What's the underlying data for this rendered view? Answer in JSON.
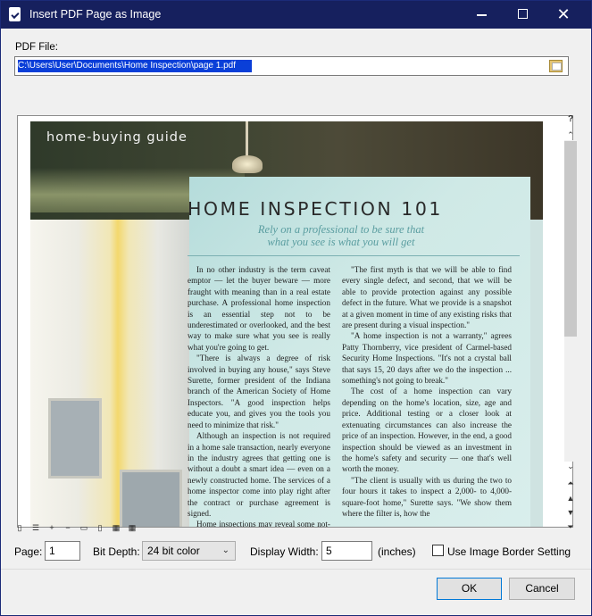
{
  "window": {
    "title": "Insert PDF Page as Image",
    "controls": {
      "minimize": "minimize",
      "maximize": "maximize",
      "close": "✕"
    }
  },
  "file": {
    "label": "PDF File:",
    "value": "C:\\Users\\User\\Documents\\Home Inspection\\page 1.pdf",
    "browse_icon": "folder-browse-icon"
  },
  "preview": {
    "kicker": "home-buying guide",
    "headline": "HOME INSPECTION 101",
    "subhead_line1": "Rely on a professional to be sure that",
    "subhead_line2": "what you see is what you will get",
    "col_a": [
      "In no other industry is the term caveat emptor — let the buyer beware — more fraught with meaning than in a real estate purchase. A professional home inspection is an essential step not to be underestimated or overlooked, and the best way to make sure what you see is really what you're going to get.",
      "\"There is always a degree of risk involved in buying any house,\" says Steve Surette, former president of the Indiana branch of the American Society of Home Inspectors. \"A good inspection helps educate you, and gives you the tools you need to minimize that risk.\"",
      "Although an inspection is not required in a home sale transaction, nearly everyone in the industry agrees that getting one is without a doubt a smart idea — even on a newly constructed home. The services of a home inspector come into play right after the contract or purchase agreement is signed.",
      "Home inspections may reveal some not-so-pleasant surprises that can make or break a sale. A thorough inspection should include"
    ],
    "col_b": [
      "\"The first myth is that we will be able to find every single defect, and second, that we will be able to provide protection against any possible defect in the future. What we provide is a snapshot at a given moment in time of any existing risks that are present during a visual inspection.\"",
      "\"A home inspection is not a warranty,\" agrees Patty Thornberry, vice president of Carmel-based Security Home Inspections. \"It's not a crystal ball that says 15, 20 days after we do the inspection ... something's not going to break.\"",
      "The cost of a home inspection can vary depending on the home's location, size, age and price. Additional testing or a closer look at extenuating circumstances can also increase the price of an inspection. However, in the end, a good inspection should be viewed as an investment in the home's safety and security — one that's well worth the money.",
      "\"The client is usually with us during the two to four hours it takes to inspect a 2,000- to 4,000-square-foot home,\" Surette says. \"We show them where the filter is, how the"
    ]
  },
  "scroll": {
    "help": "?",
    "up": "⌃",
    "down": "⌄",
    "first": "⏶",
    "prev": "▲",
    "next": "▼",
    "last": "⏷"
  },
  "view_toolbar": [
    "▯",
    "☰",
    "+",
    "−",
    "▭",
    "▯",
    "▦",
    "▦"
  ],
  "controls": {
    "page_label": "Page:",
    "page_value": "1",
    "bitdepth_label": "Bit Depth:",
    "bitdepth_value": "24 bit color",
    "width_label": "Display Width:",
    "width_value": "5",
    "width_unit": "(inches)",
    "border_label": "Use Image Border Setting",
    "border_checked": false
  },
  "buttons": {
    "ok": "OK",
    "cancel": "Cancel"
  }
}
